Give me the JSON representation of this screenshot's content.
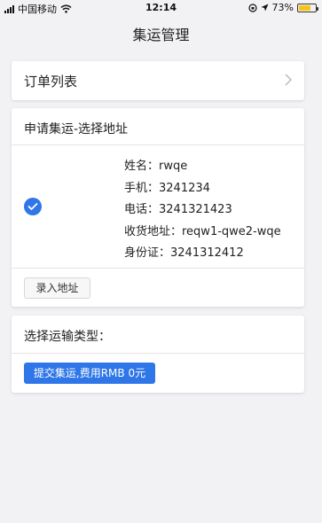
{
  "status_bar": {
    "carrier": "中国移动",
    "time": "12:14",
    "battery": "73%",
    "battery_level": 0.73
  },
  "nav": {
    "title": "集运管理"
  },
  "orders": {
    "label": "订单列表"
  },
  "address_section": {
    "title": "申请集运-选择地址",
    "lines": [
      "姓名：rwqe",
      "手机：3241234",
      "电话：3241321423",
      "收货地址：reqw1-qwe2-wqe",
      "身份证：3241312412"
    ],
    "enter_address_button": "录入地址"
  },
  "shipping_section": {
    "title": "选择运输类型：",
    "submit_button": "提交集运,费用RMB 0元"
  },
  "colors": {
    "accent": "#2f76e8",
    "background": "#f2f2f4"
  }
}
